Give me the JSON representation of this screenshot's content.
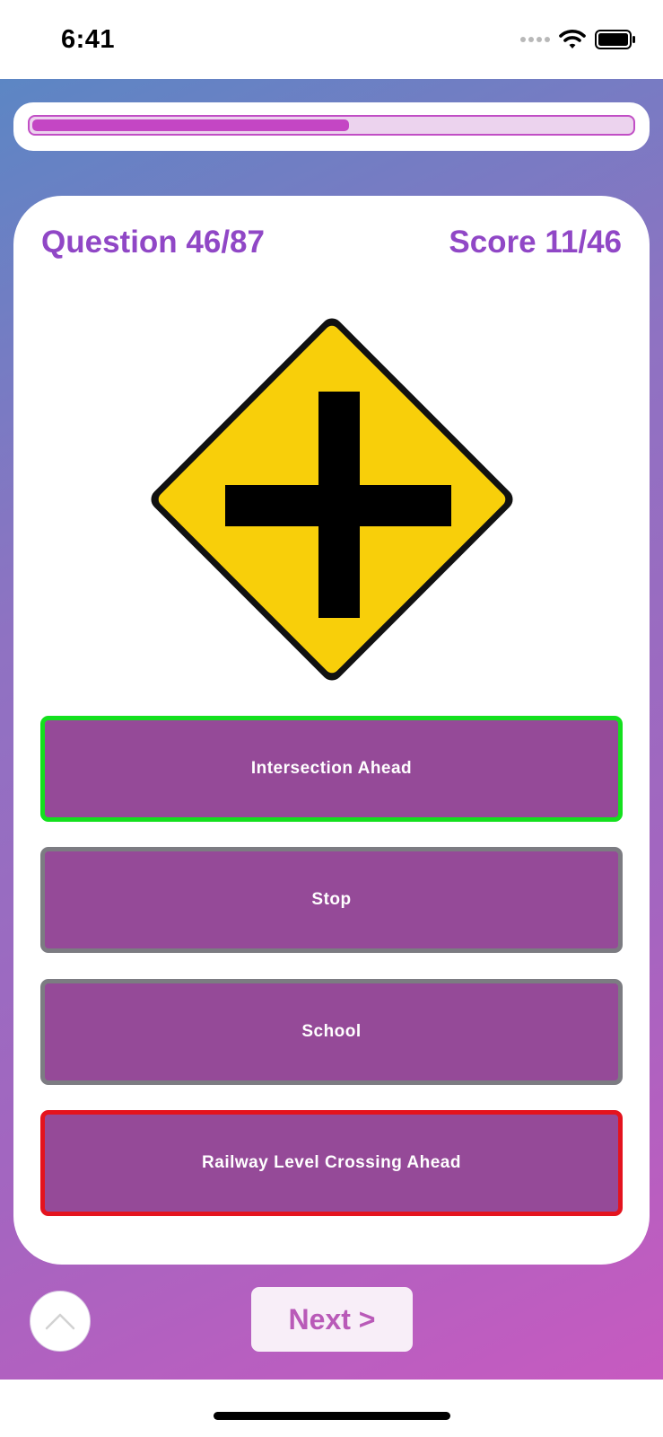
{
  "status_bar": {
    "time": "6:41",
    "signal_icon": "cellular-signal-icon",
    "wifi_icon": "wifi-icon",
    "battery_icon": "battery-icon"
  },
  "progress": {
    "fraction": 0.5287,
    "fill_color": "#c446c4",
    "track_color": "#ecd3ee"
  },
  "quiz": {
    "question_label": "Question 46/87",
    "score_label": "Score 11/46",
    "header_color": "#9047c6",
    "sign_image": "intersection-ahead-road-sign",
    "answers": [
      {
        "label": "Intersection Ahead",
        "state": "correct"
      },
      {
        "label": "Stop",
        "state": "neutral"
      },
      {
        "label": "School",
        "state": "neutral"
      },
      {
        "label": "Railway Level Crossing Ahead",
        "state": "wrong"
      }
    ],
    "answer_bg_color": "#954a98",
    "correct_border_color": "#14e01e",
    "wrong_border_color": "#e4131e"
  },
  "footer": {
    "up_icon": "chevron-up-icon",
    "next_label": "Next >"
  }
}
